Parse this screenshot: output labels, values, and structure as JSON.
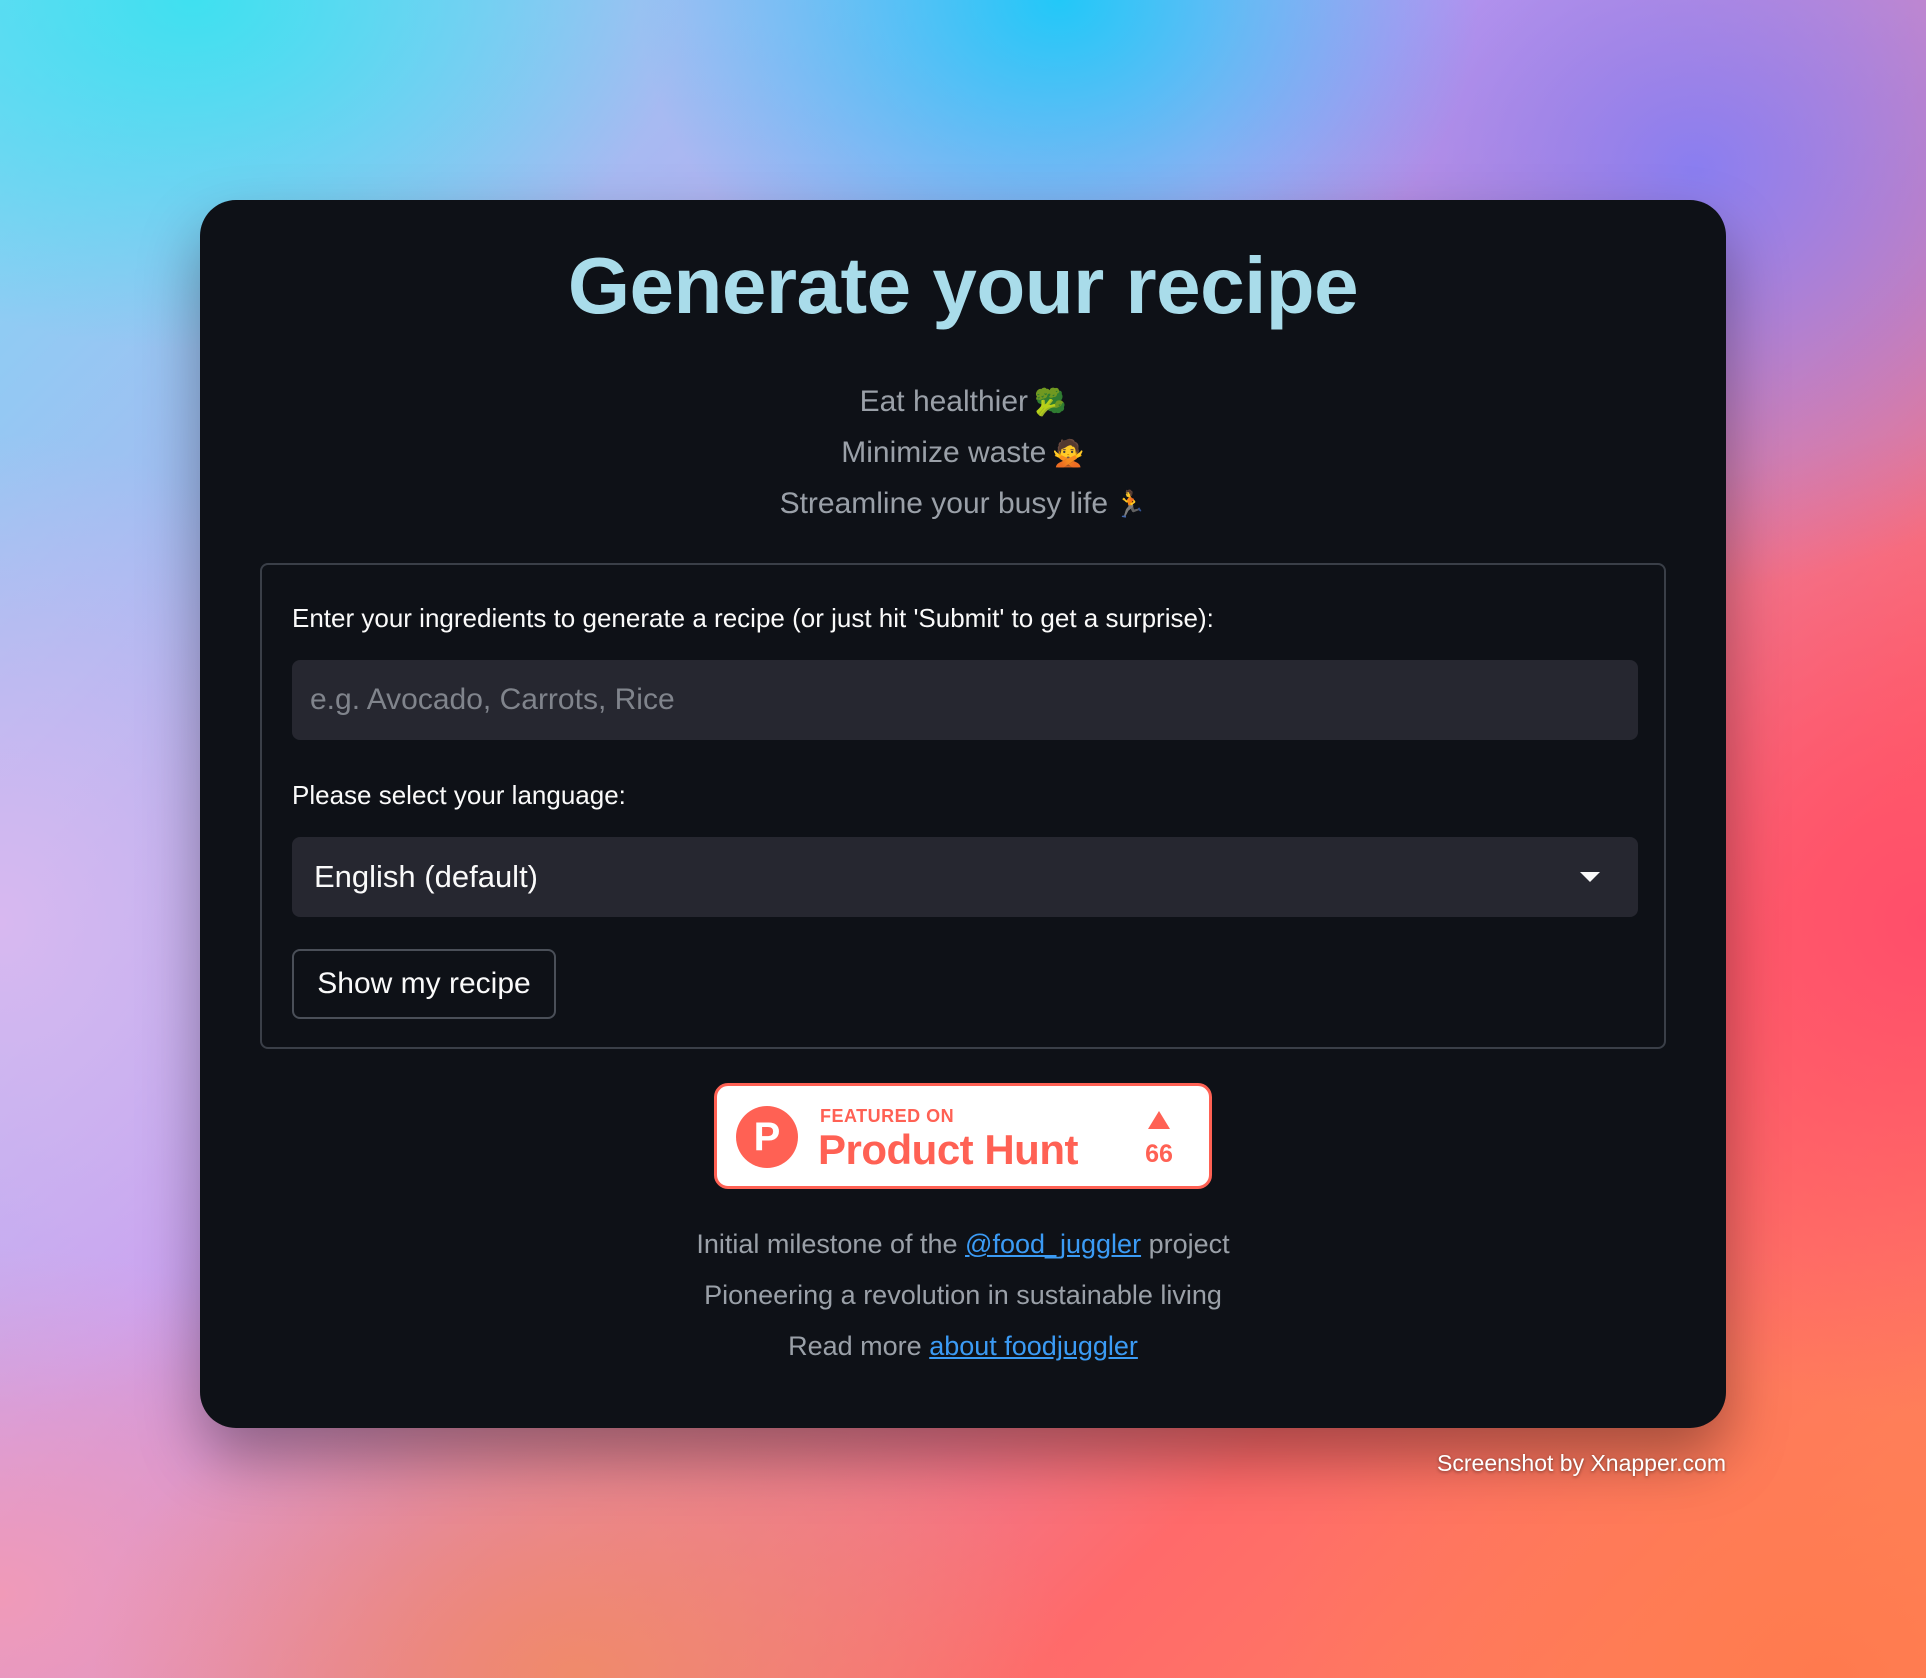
{
  "header": {
    "title": "Generate your recipe"
  },
  "taglines": [
    {
      "text": "Eat healthier",
      "emoji": "🥦"
    },
    {
      "text": "Minimize waste",
      "emoji": "🙅"
    },
    {
      "text": "Streamline your busy life",
      "emoji": "🏃"
    }
  ],
  "form": {
    "ingredients_label": "Enter your ingredients to generate a recipe (or just hit 'Submit' to get a surprise):",
    "ingredients_placeholder": "e.g. Avocado, Carrots, Rice",
    "ingredients_value": "",
    "language_label": "Please select your language:",
    "language_selected": "English (default)",
    "submit_label": "Show my recipe"
  },
  "product_hunt": {
    "featured_text": "FEATURED ON",
    "name": "Product Hunt",
    "logo_letter": "P",
    "upvotes": "66",
    "color": "#ff6154"
  },
  "footer": {
    "line1_prefix": "Initial milestone of the",
    "line1_link": "@food_juggler",
    "line1_suffix": "project",
    "line2": "Pioneering a revolution in sustainable living",
    "line3_prefix": "Read more",
    "line3_link": "about foodjuggler"
  },
  "watermark": "Screenshot by Xnapper.com",
  "colors": {
    "card_bg": "#0e1117",
    "title": "#a9dcea",
    "input_bg": "#262730",
    "link": "#3b9bf5"
  }
}
